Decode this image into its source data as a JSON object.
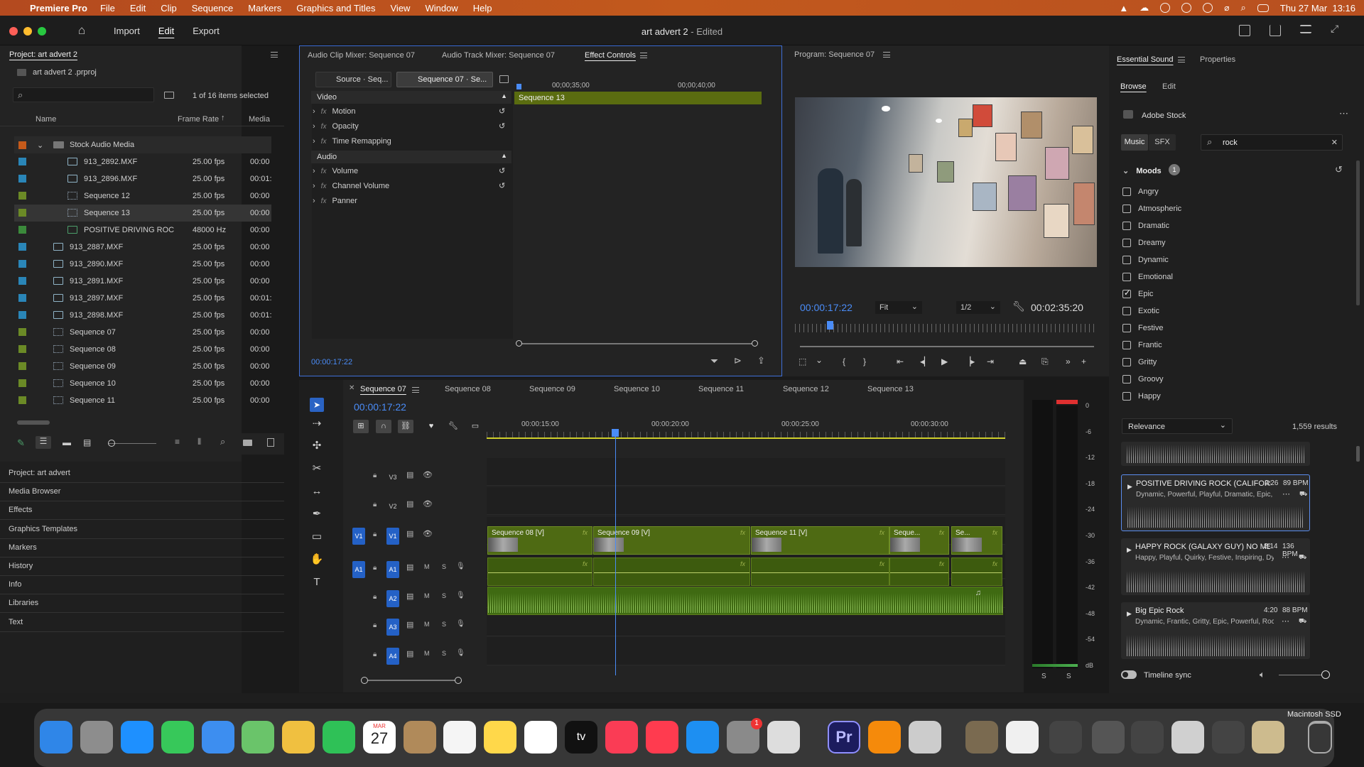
{
  "menubar": {
    "app_name": "Premiere Pro",
    "items": [
      "File",
      "Edit",
      "Clip",
      "Sequence",
      "Markers",
      "Graphics and Titles",
      "View",
      "Window",
      "Help"
    ],
    "datetime": "Thu 27 Mar  13:16"
  },
  "header": {
    "nav": {
      "import": "Import",
      "edit": "Edit",
      "export": "Export"
    },
    "doc_title": "art advert 2",
    "doc_status": " - Edited"
  },
  "project": {
    "title": "Project: art advert 2",
    "file": "art advert 2 .prproj",
    "selection_status": "1 of 16 items selected",
    "columns": {
      "name": "Name",
      "frame_rate": "Frame Rate",
      "media": "Media"
    },
    "folder": "Stock Audio Media",
    "items": [
      {
        "name": "913_2892.MXF",
        "fps": "25.00 fps",
        "media": "00:00",
        "color": "#2a86b8",
        "kind": "clip",
        "indent": true
      },
      {
        "name": "913_2896.MXF",
        "fps": "25.00 fps",
        "media": "00:01:",
        "color": "#2a86b8",
        "kind": "clip",
        "indent": true
      },
      {
        "name": "Sequence 12",
        "fps": "25.00 fps",
        "media": "00:00",
        "color": "#6b8a26",
        "kind": "seq",
        "indent": true
      },
      {
        "name": "Sequence 13",
        "fps": "25.00 fps",
        "media": "00:00",
        "color": "#6b8a26",
        "kind": "seq",
        "indent": true
      },
      {
        "name": "POSITIVE DRIVING ROC",
        "fps": "48000 Hz",
        "media": "00:00",
        "color": "#3b8a3b",
        "kind": "aud",
        "indent": true
      },
      {
        "name": "913_2887.MXF",
        "fps": "25.00 fps",
        "media": "00:00",
        "color": "#2a86b8",
        "kind": "clip",
        "indent": false
      },
      {
        "name": "913_2890.MXF",
        "fps": "25.00 fps",
        "media": "00:00",
        "color": "#2a86b8",
        "kind": "clip",
        "indent": false
      },
      {
        "name": "913_2891.MXF",
        "fps": "25.00 fps",
        "media": "00:00",
        "color": "#2a86b8",
        "kind": "clip",
        "indent": false
      },
      {
        "name": "913_2897.MXF",
        "fps": "25.00 fps",
        "media": "00:01:",
        "color": "#2a86b8",
        "kind": "clip",
        "indent": false
      },
      {
        "name": "913_2898.MXF",
        "fps": "25.00 fps",
        "media": "00:01:",
        "color": "#2a86b8",
        "kind": "clip",
        "indent": false
      },
      {
        "name": "Sequence 07",
        "fps": "25.00 fps",
        "media": "00:00",
        "color": "#6b8a26",
        "kind": "seq",
        "indent": false
      },
      {
        "name": "Sequence 08",
        "fps": "25.00 fps",
        "media": "00:00",
        "color": "#6b8a26",
        "kind": "seq",
        "indent": false
      },
      {
        "name": "Sequence 09",
        "fps": "25.00 fps",
        "media": "00:00",
        "color": "#6b8a26",
        "kind": "seq",
        "indent": false
      },
      {
        "name": "Sequence 10",
        "fps": "25.00 fps",
        "media": "00:00",
        "color": "#6b8a26",
        "kind": "seq",
        "indent": false
      },
      {
        "name": "Sequence 11",
        "fps": "25.00 fps",
        "media": "00:00",
        "color": "#6b8a26",
        "kind": "seq",
        "indent": false
      }
    ]
  },
  "left_panels": [
    "Project: art advert",
    "Media Browser",
    "Effects",
    "Graphics Templates",
    "Markers",
    "History",
    "Info",
    "Libraries",
    "Text"
  ],
  "effect_controls": {
    "tabs": [
      "Audio Clip Mixer: Sequence 07",
      "Audio Track Mixer: Sequence 07",
      "Effect Controls"
    ],
    "source_tab": "Source · Seq...",
    "seq_tab": "Sequence 07 · Se...",
    "ruler": [
      "00;00;35;00",
      "00;00;40;00"
    ],
    "clip_label": "Sequence 13",
    "video_header": "Video",
    "video_effects": [
      "Motion",
      "Opacity",
      "Time Remapping"
    ],
    "audio_header": "Audio",
    "audio_effects": [
      "Volume",
      "Channel Volume",
      "Panner"
    ],
    "timecode": "00:00:17:22"
  },
  "program": {
    "title": "Program: Sequence 07",
    "timecode": "00:00:17:22",
    "fit": "Fit",
    "resolution": "1/2",
    "duration": "00:02:35:20"
  },
  "timeline": {
    "tabs": [
      "Sequence 07",
      "Sequence 08",
      "Sequence 09",
      "Sequence 10",
      "Sequence 11",
      "Sequence 12",
      "Sequence 13"
    ],
    "timecode": "00:00:17:22",
    "ruler": [
      "00:00:15:00",
      "00:00:20:00",
      "00:00:25:00",
      "00:00:30:00"
    ],
    "tracks": [
      "V3",
      "V2",
      "V1",
      "A1",
      "A2",
      "A3",
      "A4"
    ],
    "clips": [
      "Sequence 08 [V]",
      "Sequence 09 [V]",
      "Sequence 11 [V]",
      "Seque...",
      "Se..."
    ],
    "mute_label": "M",
    "solo_label": "S"
  },
  "meter": {
    "scale": [
      "0",
      "-6",
      "-12",
      "-18",
      "-24",
      "-30",
      "-36",
      "-42",
      "-48",
      "-54",
      "dB"
    ],
    "solo": [
      "S",
      "S"
    ]
  },
  "essential_sound": {
    "tabs": [
      "Essential Sound",
      "Properties"
    ],
    "subtabs": [
      "Browse",
      "Edit"
    ],
    "provider": "Adobe Stock",
    "filter_tabs": [
      "Music",
      "SFX"
    ],
    "search_value": "rock",
    "moods_label": "Moods",
    "moods_count": "1",
    "moods": [
      {
        "label": "Angry",
        "checked": false
      },
      {
        "label": "Atmospheric",
        "checked": false
      },
      {
        "label": "Dramatic",
        "checked": false
      },
      {
        "label": "Dreamy",
        "checked": false
      },
      {
        "label": "Dynamic",
        "checked": false
      },
      {
        "label": "Emotional",
        "checked": false
      },
      {
        "label": "Epic",
        "checked": true
      },
      {
        "label": "Exotic",
        "checked": false
      },
      {
        "label": "Festive",
        "checked": false
      },
      {
        "label": "Frantic",
        "checked": false
      },
      {
        "label": "Gritty",
        "checked": false
      },
      {
        "label": "Groovy",
        "checked": false
      },
      {
        "label": "Happy",
        "checked": false
      }
    ],
    "sort": "Relevance",
    "results_count": "1,559 results",
    "results": [
      {
        "title": "POSITIVE DRIVING ROCK (CALIFORNIA)",
        "duration": "2:26",
        "bpm": "89 BPM",
        "tags": "Dynamic, Powerful, Playful, Dramatic, Epic, In..."
      },
      {
        "title": "HAPPY ROCK (GALAXY GUY) NO MEL...",
        "duration": "2:14",
        "bpm": "136 BPM",
        "tags": "Happy, Playful, Quirky, Festive, Inspiring, Dyn..."
      },
      {
        "title": "Big Epic Rock",
        "duration": "4:20",
        "bpm": "88 BPM",
        "tags": "Dynamic, Frantic, Gritty, Epic, Powerful, Rock"
      }
    ],
    "timeline_sync": "Timeline sync"
  },
  "disk_label": "Macintosh SSD",
  "dock": {
    "calendar_month": "MAR",
    "calendar_day": "27",
    "settings_badge": "1",
    "premiere_label": "Pr",
    "apple_tv_label": "tv"
  }
}
